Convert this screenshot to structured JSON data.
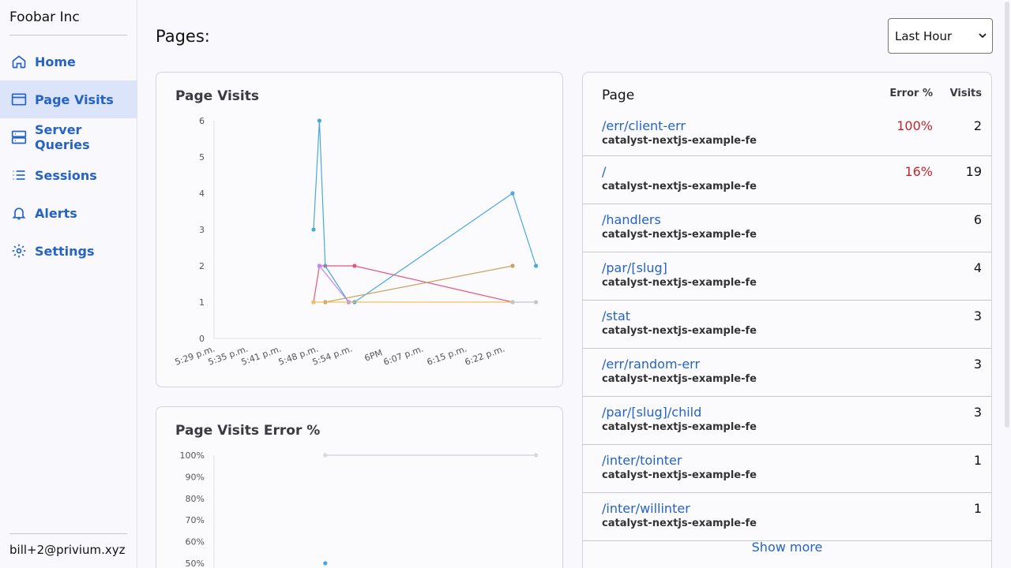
{
  "app": {
    "brand": "Foobar Inc",
    "user": "bill+2@privium.xyz"
  },
  "sidebar": {
    "items": [
      {
        "label": "Home",
        "icon": "home-icon"
      },
      {
        "label": "Page Visits",
        "icon": "window-icon",
        "active": true
      },
      {
        "label": "Server Queries",
        "icon": "server-icon"
      },
      {
        "label": "Sessions",
        "icon": "list-icon"
      },
      {
        "label": "Alerts",
        "icon": "bell-icon"
      },
      {
        "label": "Settings",
        "icon": "gear-icon"
      }
    ]
  },
  "header": {
    "title": "Pages:",
    "time_range": "Last Hour"
  },
  "colors": {
    "accent": "#2563c6",
    "error": "#c8242c",
    "active_nav_bg": "#dbe4f8"
  },
  "visits_chart": {
    "title": "Page Visits",
    "yticks": [
      "0",
      "1",
      "2",
      "3",
      "4",
      "5",
      "6"
    ],
    "xticks": [
      "5:29 p.m.",
      "5:35 p.m.",
      "5:41 p.m.",
      "5:48 p.m.",
      "5:54 p.m.",
      "6PM",
      "6:07 p.m.",
      "6:15 p.m.",
      "6:22 p.m."
    ]
  },
  "error_chart": {
    "title": "Page Visits Error %",
    "yticks": [
      "50%",
      "60%",
      "70%",
      "80%",
      "90%",
      "100%"
    ]
  },
  "chart_data": [
    {
      "type": "line",
      "title": "Page Visits",
      "ylim": [
        0,
        6
      ],
      "xlim": [
        "5:29 p.m.",
        "6:25 p.m."
      ],
      "series": [
        {
          "color": "#4aa8dc",
          "points": [
            [
              "5:46 p.m.",
              3
            ],
            [
              "5:47 p.m.",
              6
            ],
            [
              "5:48 p.m.",
              2
            ],
            [
              "5:52 p.m.",
              1
            ],
            [
              "5:53 p.m.",
              1
            ],
            [
              "6:20 p.m.",
              4
            ],
            [
              "6:24 p.m.",
              2
            ]
          ]
        },
        {
          "color": "#e8557a",
          "points": [
            [
              "5:46 p.m.",
              1
            ],
            [
              "5:47 p.m.",
              2
            ],
            [
              "5:53 p.m.",
              2
            ],
            [
              "6:20 p.m.",
              1
            ]
          ]
        },
        {
          "color": "#c084fc",
          "points": [
            [
              "5:47 p.m.",
              2
            ],
            [
              "5:52 p.m.",
              1
            ]
          ]
        },
        {
          "color": "#c9a15e",
          "points": [
            [
              "5:48 p.m.",
              1
            ],
            [
              "6:20 p.m.",
              2
            ]
          ]
        },
        {
          "color": "#f0c060",
          "points": [
            [
              "5:46 p.m.",
              1
            ],
            [
              "6:20 p.m.",
              1
            ]
          ]
        },
        {
          "color": "#c4c4cc",
          "points": [
            [
              "6:20 p.m.",
              1
            ],
            [
              "6:24 p.m.",
              1
            ]
          ]
        }
      ]
    },
    {
      "type": "line",
      "title": "Page Visits Error %",
      "ylim": [
        50,
        100
      ],
      "series": [
        {
          "color": "#d8d8de",
          "points": [
            [
              "5:48 p.m.",
              100
            ],
            [
              "6:24 p.m.",
              100
            ]
          ]
        },
        {
          "color": "#4aa8dc",
          "points": [
            [
              "5:48 p.m.",
              50
            ]
          ]
        }
      ]
    }
  ],
  "table": {
    "col_page": "Page",
    "col_error": "Error %",
    "col_visits": "Visits",
    "rows": [
      {
        "path": "/err/client-err",
        "service": "catalyst-nextjs-example-fe",
        "error": "100%",
        "visits": "2"
      },
      {
        "path": "/",
        "service": "catalyst-nextjs-example-fe",
        "error": "16%",
        "visits": "19"
      },
      {
        "path": "/handlers",
        "service": "catalyst-nextjs-example-fe",
        "error": "",
        "visits": "6"
      },
      {
        "path": "/par/[slug]",
        "service": "catalyst-nextjs-example-fe",
        "error": "",
        "visits": "4"
      },
      {
        "path": "/stat",
        "service": "catalyst-nextjs-example-fe",
        "error": "",
        "visits": "3"
      },
      {
        "path": "/err/random-err",
        "service": "catalyst-nextjs-example-fe",
        "error": "",
        "visits": "3"
      },
      {
        "path": "/par/[slug]/child",
        "service": "catalyst-nextjs-example-fe",
        "error": "",
        "visits": "3"
      },
      {
        "path": "/inter/tointer",
        "service": "catalyst-nextjs-example-fe",
        "error": "",
        "visits": "1"
      },
      {
        "path": "/inter/willinter",
        "service": "catalyst-nextjs-example-fe",
        "error": "",
        "visits": "1"
      }
    ],
    "show_more": "Show more"
  }
}
